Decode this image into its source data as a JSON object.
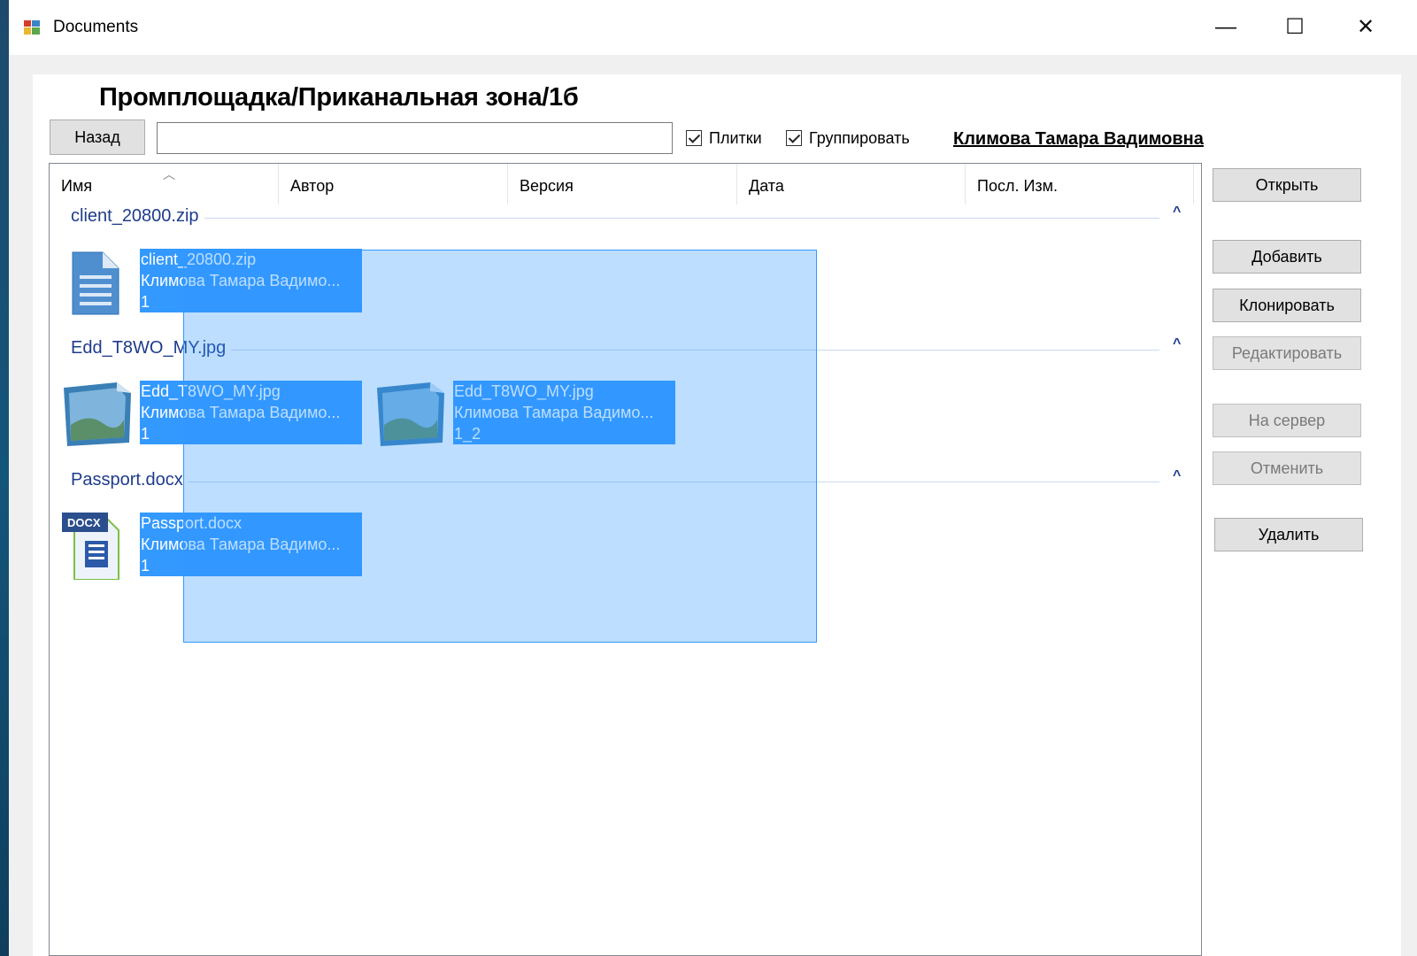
{
  "window": {
    "title": "Documents",
    "controls": {
      "minimize": "—",
      "maximize": "☐",
      "close": "✕"
    }
  },
  "header": {
    "path_title": "Промплощадка/Приканальная зона/1б",
    "back_label": "Назад",
    "search_value": "",
    "tiles_checkbox": {
      "label": "Плитки",
      "checked": true
    },
    "group_checkbox": {
      "label": "Группировать",
      "checked": true
    },
    "user_name": "Климова Тамара Вадимовна"
  },
  "columns": [
    "Имя",
    "Автор",
    "Версия",
    "Дата",
    "Посл. Изм."
  ],
  "groups": [
    {
      "title": "client_20800.zip",
      "items": [
        {
          "icon": "zip-document-icon",
          "name": "client_20800.zip",
          "author": "Климова Тамара Вадимо...",
          "version": "1"
        }
      ]
    },
    {
      "title": "Edd_T8WO_MY.jpg",
      "items": [
        {
          "icon": "image-file-icon",
          "name": "Edd_T8WO_MY.jpg",
          "author": "Климова Тамара Вадимо...",
          "version": "1"
        },
        {
          "icon": "image-file-icon",
          "name": "Edd_T8WO_MY.jpg",
          "author": "Климова Тамара Вадимо...",
          "version": "1_2"
        }
      ]
    },
    {
      "title": "Passport.docx",
      "items": [
        {
          "icon": "docx-file-icon",
          "name": "Passport.docx",
          "author": "Климова Тамара Вадимо...",
          "version": "1"
        }
      ]
    }
  ],
  "actions": {
    "open": "Открыть",
    "add": "Добавить",
    "clone": "Клонировать",
    "edit": "Редактировать",
    "to_server": "На сервер",
    "cancel": "Отменить",
    "delete": "Удалить"
  },
  "colors": {
    "selection": "#3399ff",
    "group_title": "#1e3c8c",
    "desktop": "#14557a"
  }
}
